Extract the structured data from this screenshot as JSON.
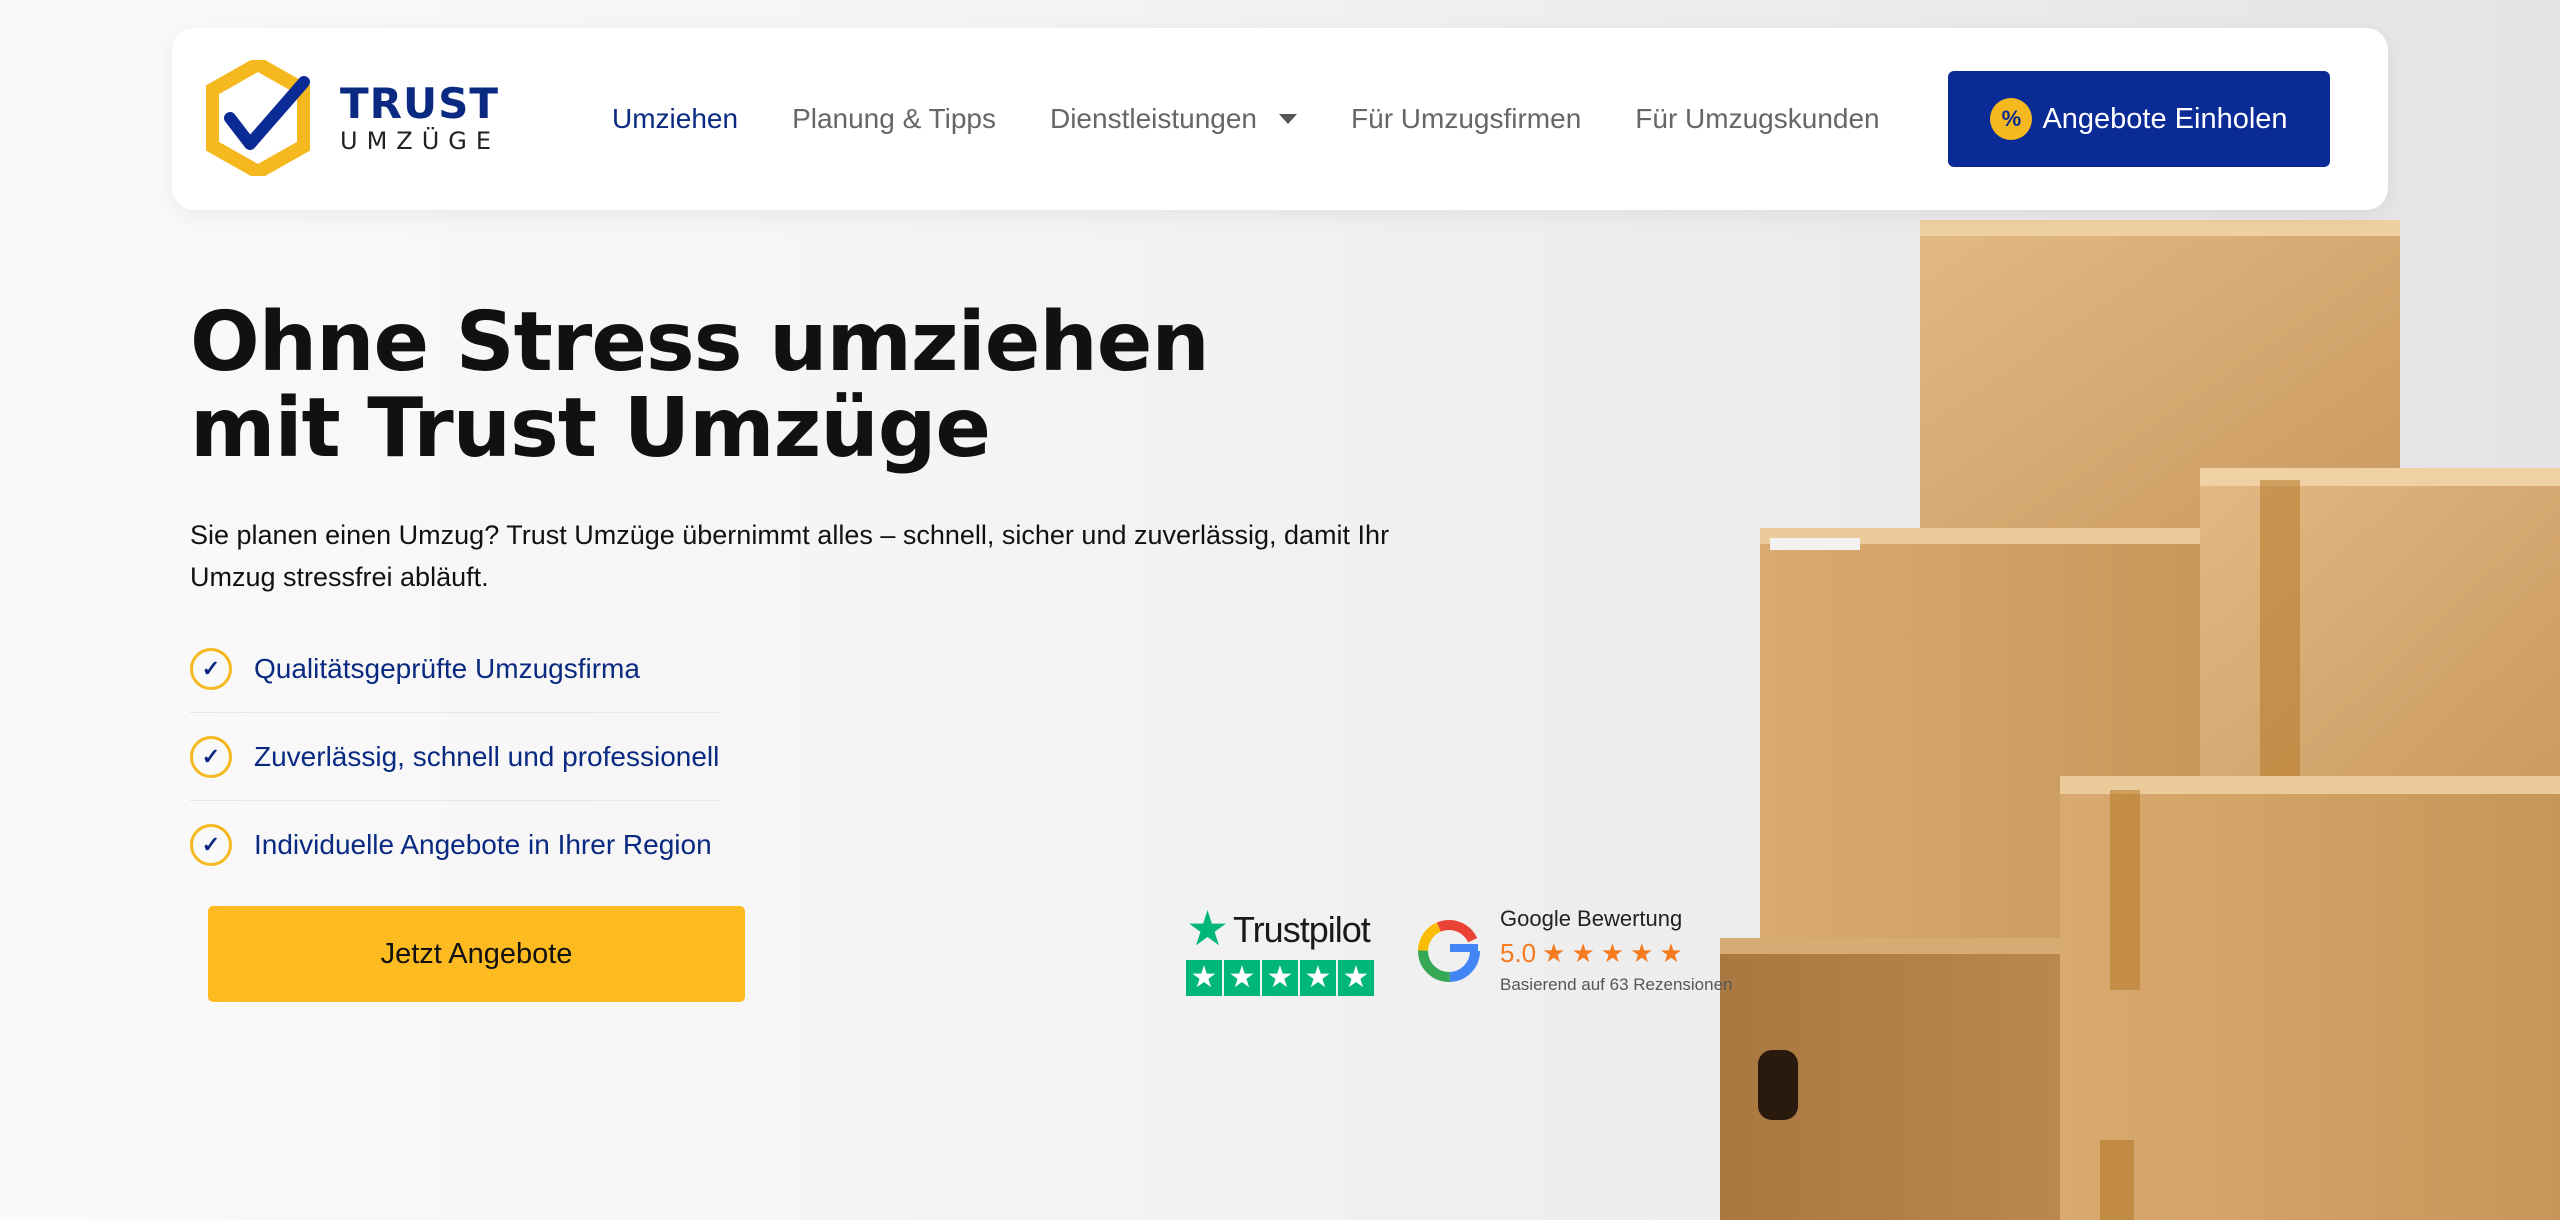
{
  "brand": {
    "line1": "TRUST",
    "line2": "UMZÜGE"
  },
  "nav": {
    "items": [
      {
        "label": "Umziehen",
        "active": true
      },
      {
        "label": "Planung & Tipps"
      },
      {
        "label": "Dienstleistungen",
        "has_dropdown": true
      },
      {
        "label": "Für Umzugsfirmen"
      },
      {
        "label": "Für Umzugskunden"
      }
    ],
    "cta_label": "Angebote Einholen",
    "cta_icon": "percent-badge-icon"
  },
  "hero": {
    "title_line1": "Ohne Stress umziehen",
    "title_line2": "mit Trust Umzüge",
    "subtitle": "Sie planen einen Umzug? Trust Umzüge übernimmt alles – schnell, sicher und zuverlässig, damit Ihr Umzug stressfrei abläuft.",
    "features": [
      "Qualitätsgeprüfte Umzugsfirma",
      "Zuverlässig, schnell und professionell",
      "Individuelle Angebote in Ihrer Region"
    ],
    "cta_label": "Jetzt Angebote"
  },
  "ratings": {
    "trustpilot": {
      "name": "Trustpilot",
      "stars": 5
    },
    "google": {
      "title": "Google Bewertung",
      "score": "5.0",
      "stars": 5,
      "based_on": "Basierend auf  63  Rezensionen"
    }
  },
  "colors": {
    "brand_blue": "#0a2a95",
    "brand_yellow": "#fdbb21",
    "trustpilot_green": "#00b67a",
    "google_orange": "#f47b20"
  }
}
